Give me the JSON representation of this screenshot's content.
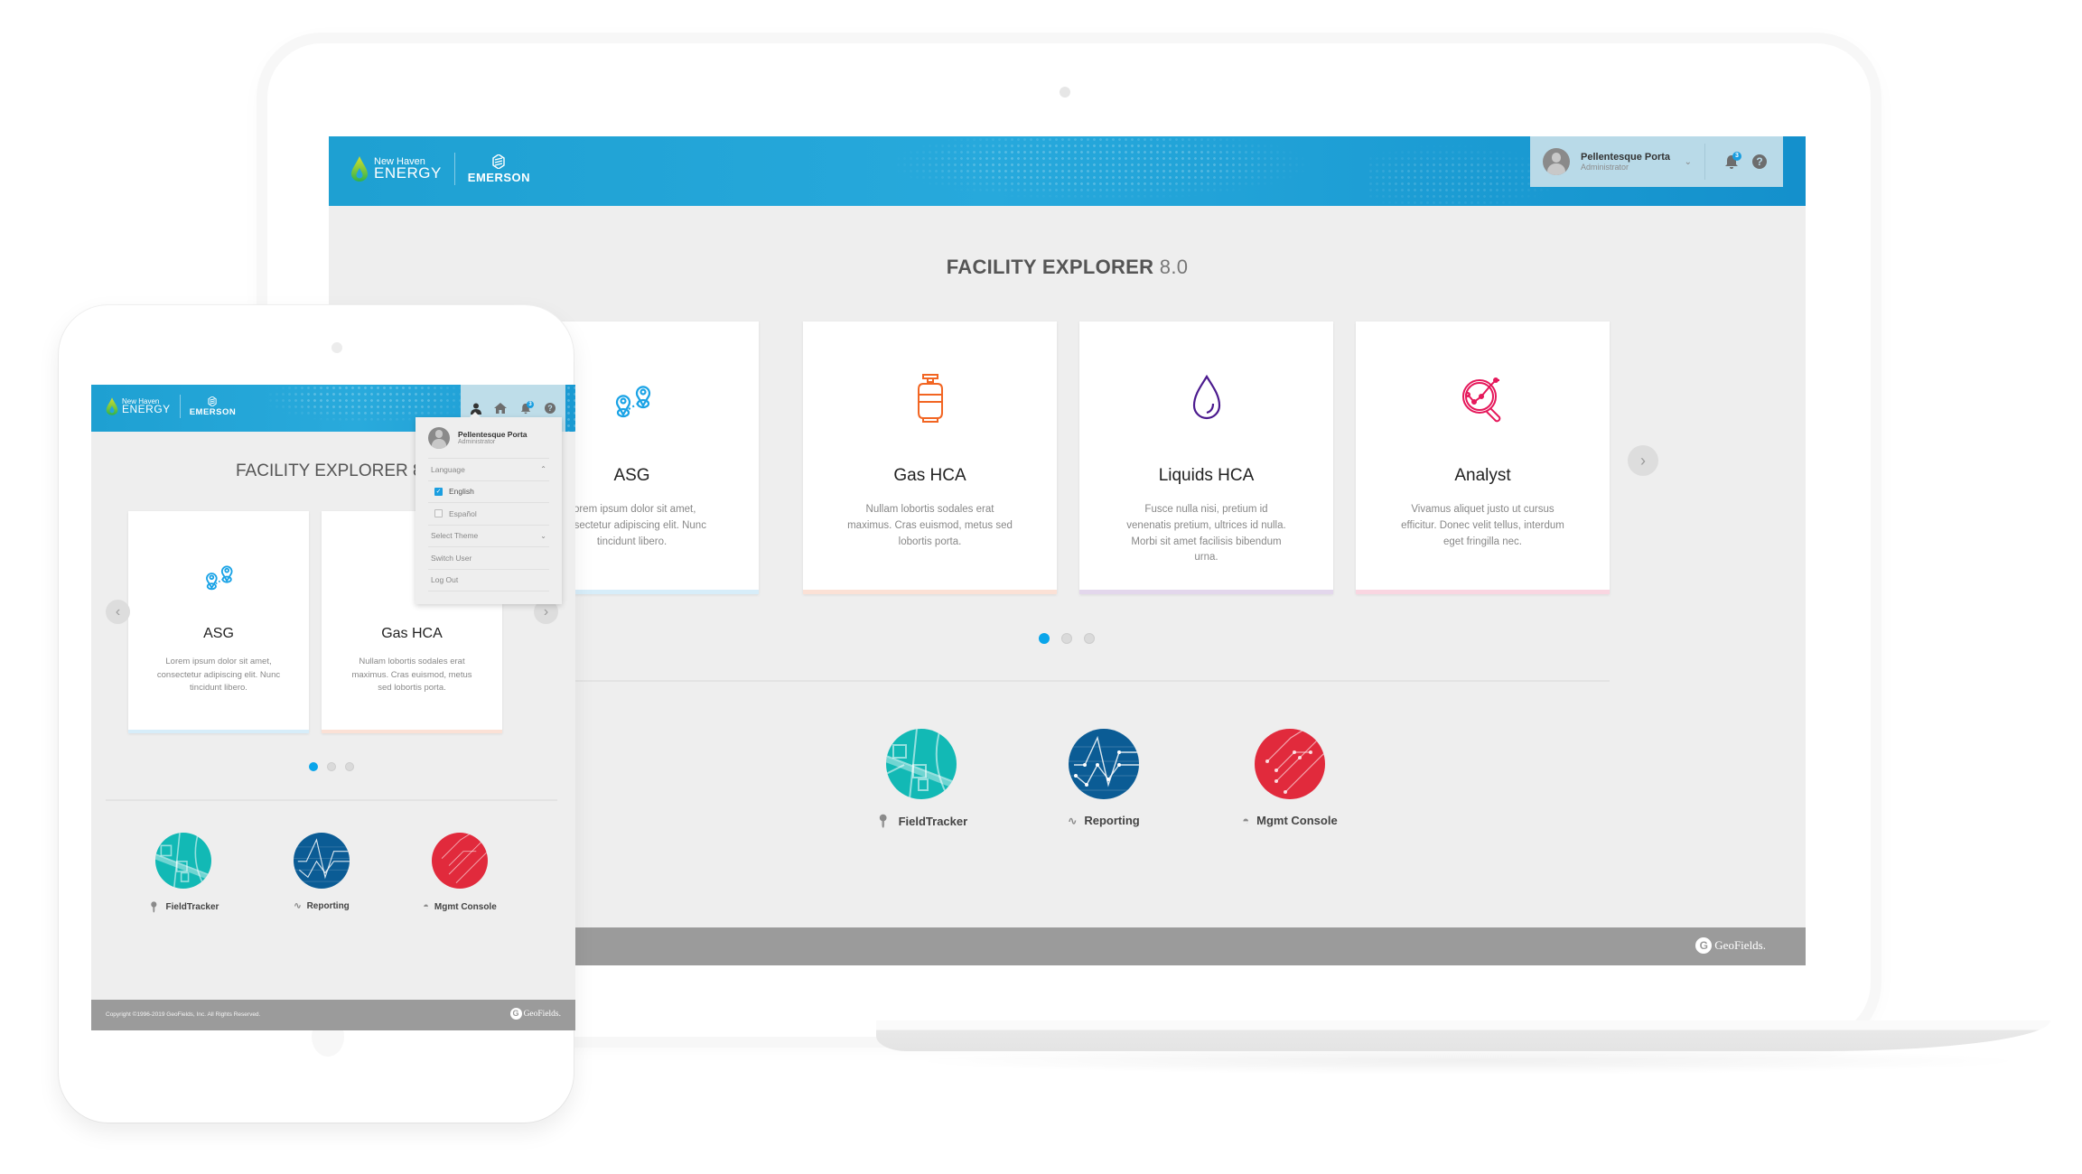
{
  "colors": {
    "header_blue": "#1ea0d2",
    "accent": "#0aa5ea",
    "page_bg": "#eeeeee",
    "footer_gray": "#9b9b9b"
  },
  "brand": {
    "client_line1": "New Haven",
    "client_line2": "ENERGY",
    "partner": "EMERSON",
    "vendor": "GeoFields."
  },
  "user": {
    "name": "Pellentesque Porta",
    "role": "Administrator",
    "notification_count": "3"
  },
  "page": {
    "title": "FACILITY EXPLORER",
    "version": "8.0",
    "tablet_title_visible": "FACILITY EXPLORER 8"
  },
  "cards": [
    {
      "title": "ASG",
      "description": "Lorem ipsum dolor sit amet, consectetur adipiscing elit. Nunc tincidunt libero.",
      "visible_description_laptop": "m ipsum dolor sit amet, tetur adipiscing elit. Nunc tincidunt libero.",
      "icon": "map-pins-route-icon",
      "color": "#1aa3e6",
      "bar_color": "#d7edf9"
    },
    {
      "title": "Gas HCA",
      "description": "Nullam lobortis sodales erat maximus. Cras euismod, metus sed lobortis porta.",
      "icon": "gas-cylinder-icon",
      "color": "#f26522",
      "bar_color": "#fbe1d6"
    },
    {
      "title": "Liquids HCA",
      "description": "Fusce nulla nisi, pretium id venenatis pretium, ultrices id nulla. Morbi sit amet facilisis bibendum urna.",
      "icon": "liquid-drop-icon",
      "color": "#4b1a8e",
      "bar_color": "#e3d7ec"
    },
    {
      "title": "Analyst",
      "description": "Vivamus aliquet justo ut cursus efficitur. Donec velit tellus, interdum eget fringilla nec.",
      "icon": "magnifier-chart-icon",
      "color": "#e5175a",
      "bar_color": "#f9d6e1"
    }
  ],
  "carousel": {
    "pages": 3,
    "active_page": 1,
    "prev_icon": "chevron-left-icon",
    "next_icon": "chevron-right-icon"
  },
  "apps": [
    {
      "label": "FieldTracker",
      "icon": "location-pin-icon",
      "color": "#12b9b5"
    },
    {
      "label": "Reporting",
      "icon": "line-chart-icon",
      "color": "#0b5c95"
    },
    {
      "label": "Mgmt Console",
      "icon": "dashboard-gauge-icon",
      "color": "#e12a3c"
    }
  ],
  "user_menu": {
    "language_label": "Language",
    "languages": [
      {
        "label": "English",
        "checked": true
      },
      {
        "label": "Español",
        "checked": false
      }
    ],
    "theme_label": "Select Theme",
    "switch_user": "Switch User",
    "log_out": "Log Out"
  },
  "footer": {
    "copyright": "Copyright ©1996-2019 GeoFields, Inc. All Rights Reserved."
  }
}
